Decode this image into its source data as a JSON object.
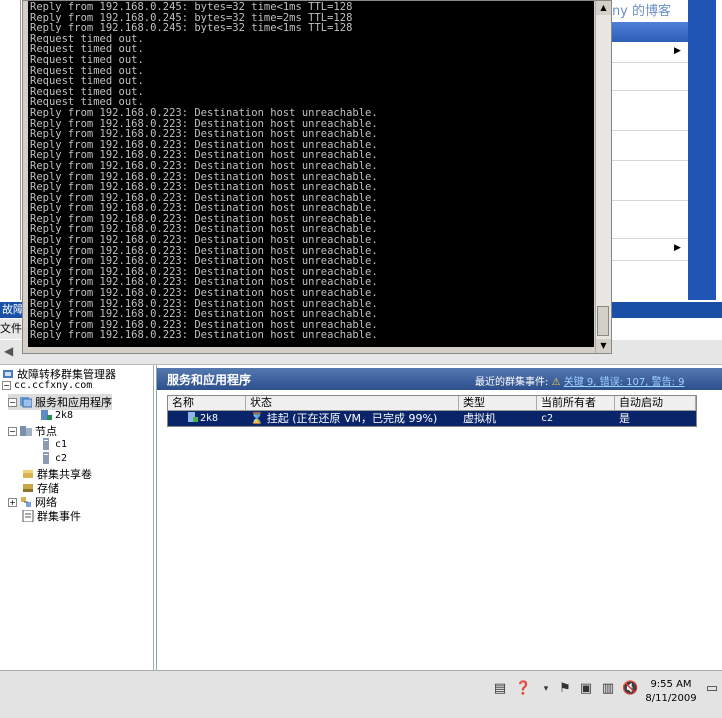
{
  "watermark": "dxny 的博客",
  "mmc": {
    "title": "故障",
    "menu_label": "文件(F"
  },
  "tree": {
    "root": "故障转移群集管理器",
    "cluster": "cc.ccfxny.com",
    "services": "服务和应用程序",
    "service_item": "2k8",
    "nodes": "节点",
    "node1": "c1",
    "node2": "c2",
    "shared_volumes": "群集共享卷",
    "storage": "存储",
    "network": "网络",
    "events": "群集事件"
  },
  "right_pane": {
    "title": "服务和应用程序",
    "events_label": "最近的群集事件:",
    "events_value": "关键 9, 错误: 107, 警告: 9",
    "columns": [
      "名称",
      "状态",
      "类型",
      "当前所有者",
      "自动启动"
    ],
    "rows": [
      {
        "name": "2k8",
        "status": "挂起 (正在还原 VM，已完成 99%)",
        "type": "虚拟机",
        "owner": "c2",
        "autostart": "是"
      }
    ]
  },
  "clock": {
    "time": "9:55 AM",
    "date": "8/11/2009"
  },
  "cmd": {
    "lines": [
      "Reply from 192.168.0.245: bytes=32 time<1ms TTL=128",
      "Reply from 192.168.0.245: bytes=32 time=2ms TTL=128",
      "Reply from 192.168.0.245: bytes=32 time<1ms TTL=128",
      "Request timed out.",
      "Request timed out.",
      "Request timed out.",
      "Request timed out.",
      "Request timed out.",
      "Request timed out.",
      "Request timed out.",
      "Reply from 192.168.0.223: Destination host unreachable.",
      "Reply from 192.168.0.223: Destination host unreachable.",
      "Reply from 192.168.0.223: Destination host unreachable.",
      "Reply from 192.168.0.223: Destination host unreachable.",
      "Reply from 192.168.0.223: Destination host unreachable.",
      "Reply from 192.168.0.223: Destination host unreachable.",
      "Reply from 192.168.0.223: Destination host unreachable.",
      "Reply from 192.168.0.223: Destination host unreachable.",
      "Reply from 192.168.0.223: Destination host unreachable.",
      "Reply from 192.168.0.223: Destination host unreachable.",
      "Reply from 192.168.0.223: Destination host unreachable.",
      "Reply from 192.168.0.223: Destination host unreachable.",
      "Reply from 192.168.0.223: Destination host unreachable.",
      "Reply from 192.168.0.223: Destination host unreachable.",
      "Reply from 192.168.0.223: Destination host unreachable.",
      "Reply from 192.168.0.223: Destination host unreachable.",
      "Reply from 192.168.0.223: Destination host unreachable.",
      "Reply from 192.168.0.223: Destination host unreachable.",
      "Reply from 192.168.0.223: Destination host unreachable.",
      "Reply from 192.168.0.223: Destination host unreachable.",
      "Reply from 192.168.0.223: Destination host unreachable.",
      "Reply from 192.168.0.223: Destination host unreachable."
    ]
  },
  "colors": {
    "titlebar": "#1a4fa8",
    "selection": "#0a246a",
    "console_text": "#c0c0c0"
  }
}
